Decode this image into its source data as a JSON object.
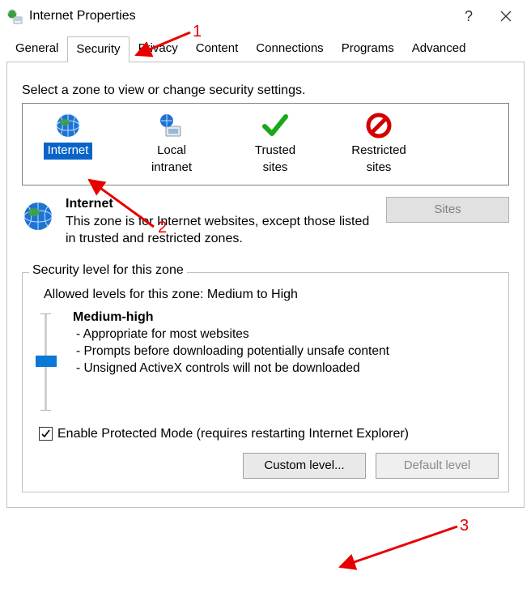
{
  "window": {
    "title": "Internet Properties"
  },
  "tabs": [
    "General",
    "Security",
    "Privacy",
    "Content",
    "Connections",
    "Programs",
    "Advanced"
  ],
  "active_tab": "Security",
  "zone_instruction": "Select a zone to view or change security settings.",
  "zones": {
    "internet": {
      "label1": "Internet",
      "label2": ""
    },
    "intranet": {
      "label1": "Local",
      "label2": "intranet"
    },
    "trusted": {
      "label1": "Trusted",
      "label2": "sites"
    },
    "restricted": {
      "label1": "Restricted",
      "label2": "sites"
    }
  },
  "zone_desc": {
    "title": "Internet",
    "text": "This zone is for Internet websites, except those listed in trusted and restricted zones."
  },
  "sites_button": "Sites",
  "fieldset_legend": "Security level for this zone",
  "allowed_levels": "Allowed levels for this zone: Medium to High",
  "level": {
    "name": "Medium-high",
    "b1": "- Appropriate for most websites",
    "b2": "- Prompts before downloading potentially unsafe content",
    "b3": "- Unsigned ActiveX controls will not be downloaded"
  },
  "protected_mode": {
    "checked": true,
    "label": "Enable Protected Mode (requires restarting Internet Explorer)"
  },
  "buttons": {
    "custom": "Custom level...",
    "default": "Default level"
  },
  "annotations": {
    "n1": "1",
    "n2": "2",
    "n3": "3"
  }
}
